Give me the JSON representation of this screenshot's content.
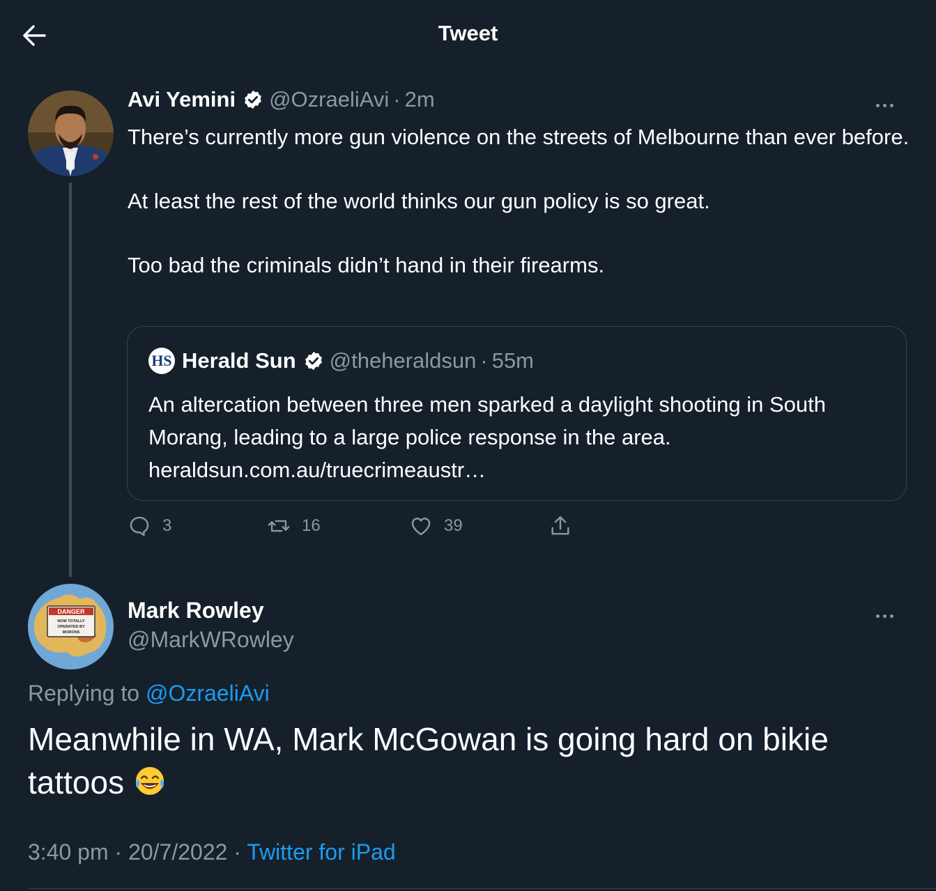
{
  "header": {
    "title": "Tweet",
    "back_icon": "arrow-left-icon"
  },
  "colors": {
    "background": "#15202b",
    "secondary_text": "#8b98a5",
    "link": "#1d9bf0",
    "border": "#38444d"
  },
  "parent_tweet": {
    "name": "Avi Yemini",
    "handle": "@OzraeliAvi",
    "separator": "·",
    "time": "2m",
    "text": [
      "There’s currently more gun violence on the streets of Melbourne than ever before.",
      "At least the rest of the world thinks our gun policy is so great.",
      "Too bad the criminals didn’t hand in their firearms."
    ],
    "quote": {
      "logo_text": "HS",
      "name": "Herald Sun",
      "handle": "@theheraldsun",
      "separator": "·",
      "time": "55m",
      "text_line1": "An altercation between three men sparked a daylight shooting in South Morang, leading to a large police response in the area.",
      "link": "heraldsun.com.au/truecrimeaustr…"
    },
    "actions": {
      "replies": "3",
      "retweets": "16",
      "likes": "39"
    }
  },
  "reply_tweet": {
    "name": "Mark Rowley",
    "handle": "@MarkWRowley",
    "replying_prefix": "Replying to",
    "replying_handle": "@OzraeliAvi",
    "text": "Meanwhile in WA, Mark McGowan is going hard on bikie tattoos",
    "emoji": "face-with-tears-of-joy-icon",
    "avatar_sign": {
      "line1": "DANGER",
      "line2": "NOW TOTALLY",
      "line3": "OPERATED BY",
      "line4": "MORONS"
    },
    "time": "3:40 pm",
    "separator": "·",
    "date": "20/7/2022",
    "source": "Twitter for iPad"
  }
}
